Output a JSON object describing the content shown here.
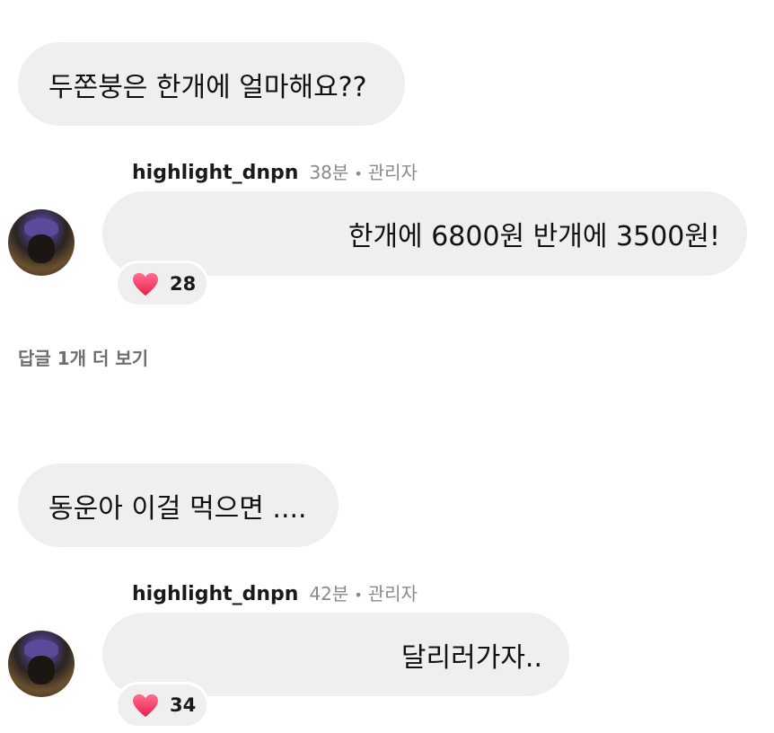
{
  "thread1": {
    "question": "두쫀붕은 한개에 얼마해요??",
    "reply": {
      "username": "highlight_dnpn",
      "time": "38분",
      "separator": "•",
      "role": "관리자",
      "text": "한개에 6800원 반개에 3500원!",
      "like_icon": "heart-icon",
      "likes": "28"
    },
    "more_replies": "답글 1개 더 보기"
  },
  "thread2": {
    "question": "동운아 이걸 먹으면 ....",
    "reply": {
      "username": "highlight_dnpn",
      "time": "42분",
      "separator": "•",
      "role": "관리자",
      "text": "달리러가자..",
      "like_icon": "heart-icon",
      "likes": "34"
    }
  },
  "colors": {
    "bubble": "#efefef",
    "heart": "#f0406a",
    "muted_text": "#8a8a8a"
  }
}
